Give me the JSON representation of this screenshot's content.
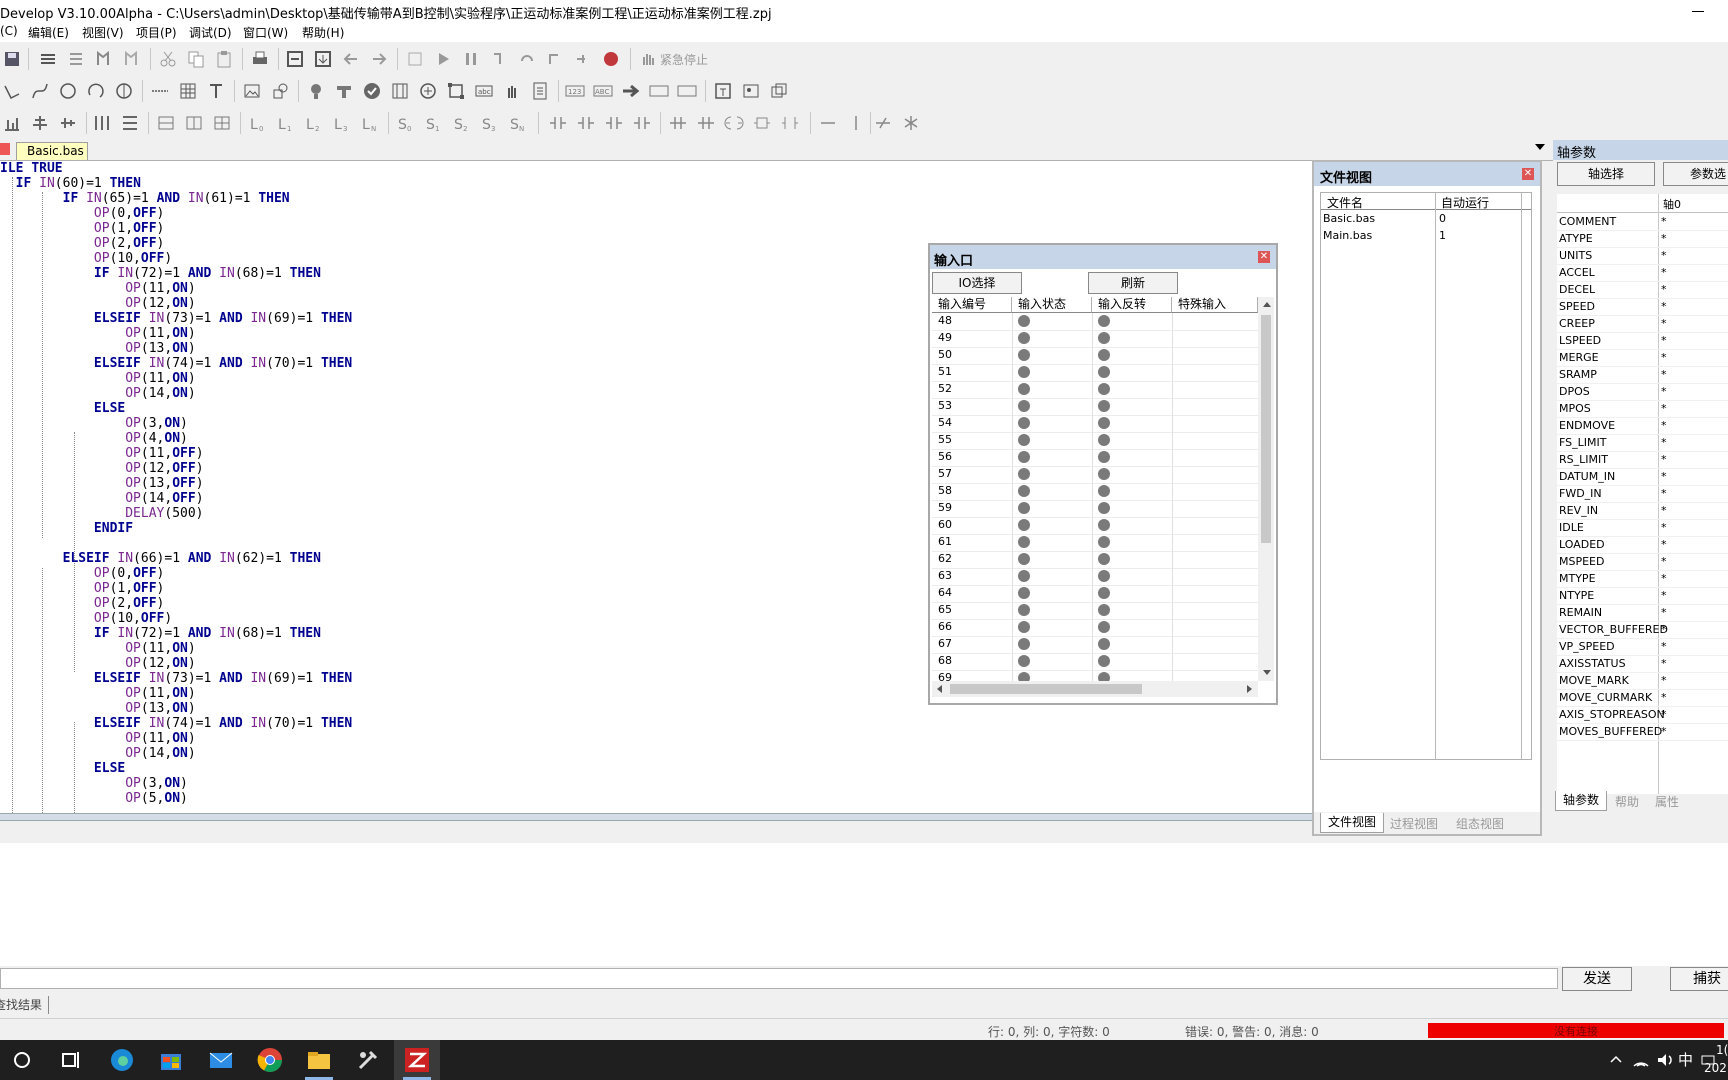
{
  "window": {
    "title": "Develop V3.10.00Alpha - C:\\Users\\admin\\Desktop\\基础传输带A到B控制\\实验程序\\正运动标准案例工程\\正运动标准案例工程.zpj"
  },
  "menu": [
    "(C)",
    "编辑(E)",
    "视图(V)",
    "项目(P)",
    "调试(D)",
    "窗口(W)",
    "帮助(H)"
  ],
  "toolbar": {
    "emergency_stop": "紧急停止"
  },
  "doc_tab": {
    "label": "Basic.bas"
  },
  "code_lines": [
    "ILE TRUE",
    "  IF IN(60)=1 THEN",
    "        IF IN(65)=1 AND IN(61)=1 THEN",
    "            OP(0,OFF)",
    "            OP(1,OFF)",
    "            OP(2,OFF)",
    "            OP(10,OFF)",
    "            IF IN(72)=1 AND IN(68)=1 THEN",
    "                OP(11,ON)",
    "                OP(12,ON)",
    "            ELSEIF IN(73)=1 AND IN(69)=1 THEN",
    "                OP(11,ON)",
    "                OP(13,ON)",
    "            ELSEIF IN(74)=1 AND IN(70)=1 THEN",
    "                OP(11,ON)",
    "                OP(14,ON)",
    "            ELSE",
    "                OP(3,ON)",
    "                OP(4,ON)",
    "                OP(11,OFF)",
    "                OP(12,OFF)",
    "                OP(13,OFF)",
    "                OP(14,OFF)",
    "                DELAY(500)",
    "            ENDIF",
    "",
    "        ELSEIF IN(66)=1 AND IN(62)=1 THEN",
    "            OP(0,OFF)",
    "            OP(1,OFF)",
    "            OP(2,OFF)",
    "            OP(10,OFF)",
    "            IF IN(72)=1 AND IN(68)=1 THEN",
    "                OP(11,ON)",
    "                OP(12,ON)",
    "            ELSEIF IN(73)=1 AND IN(69)=1 THEN",
    "                OP(11,ON)",
    "                OP(13,ON)",
    "            ELSEIF IN(74)=1 AND IN(70)=1 THEN",
    "                OP(11,ON)",
    "                OP(14,ON)",
    "            ELSE",
    "                OP(3,ON)",
    "                OP(5,ON)"
  ],
  "io_dialog": {
    "title": "输入口",
    "io_select_btn": "IO选择",
    "refresh_btn": "刷新",
    "columns": [
      "输入编号",
      "输入状态",
      "输入反转",
      "特殊输入"
    ],
    "rows": [
      "48",
      "49",
      "50",
      "51",
      "52",
      "53",
      "54",
      "55",
      "56",
      "57",
      "58",
      "59",
      "60",
      "61",
      "62",
      "63",
      "64",
      "65",
      "66",
      "67",
      "68",
      "69"
    ]
  },
  "file_view": {
    "title": "文件视图",
    "columns": [
      "文件名",
      "自动运行"
    ],
    "files": [
      {
        "name": "Basic.bas",
        "autorun": "0"
      },
      {
        "name": "Main.bas",
        "autorun": "1"
      }
    ],
    "tabs": [
      "文件视图",
      "过程视图",
      "组态视图"
    ]
  },
  "axis_panel": {
    "title": "轴参数",
    "axis_select_btn": "轴选择",
    "param_select_btn": "参数选",
    "axis_column": "轴0",
    "params": [
      "COMMENT",
      "ATYPE",
      "UNITS",
      "ACCEL",
      "DECEL",
      "SPEED",
      "CREEP",
      "LSPEED",
      "MERGE",
      "SRAMP",
      "DPOS",
      "MPOS",
      "ENDMOVE",
      "FS_LIMIT",
      "RS_LIMIT",
      "DATUM_IN",
      "FWD_IN",
      "REV_IN",
      "IDLE",
      "LOADED",
      "MSPEED",
      "MTYPE",
      "NTYPE",
      "REMAIN",
      "VECTOR_BUFFERED",
      "VP_SPEED",
      "AXISSTATUS",
      "MOVE_MARK",
      "MOVE_CURMARK",
      "AXIS_STOPREASON",
      "MOVES_BUFFERED"
    ],
    "value": "*",
    "tabs": [
      "轴参数",
      "帮助",
      "属性"
    ]
  },
  "command": {
    "send_btn": "发送",
    "capture_btn": "捕获"
  },
  "find_results_label": "查找结果",
  "status": {
    "position": "行: 0, 列: 0, 字符数: 0",
    "messages": "错误: 0, 警告: 0, 消息: 0",
    "connection": "没有连接",
    "connection_color": "#ee0000"
  },
  "taskbar": {
    "ime": "中",
    "clock_time": "1(",
    "clock_date": "202"
  }
}
